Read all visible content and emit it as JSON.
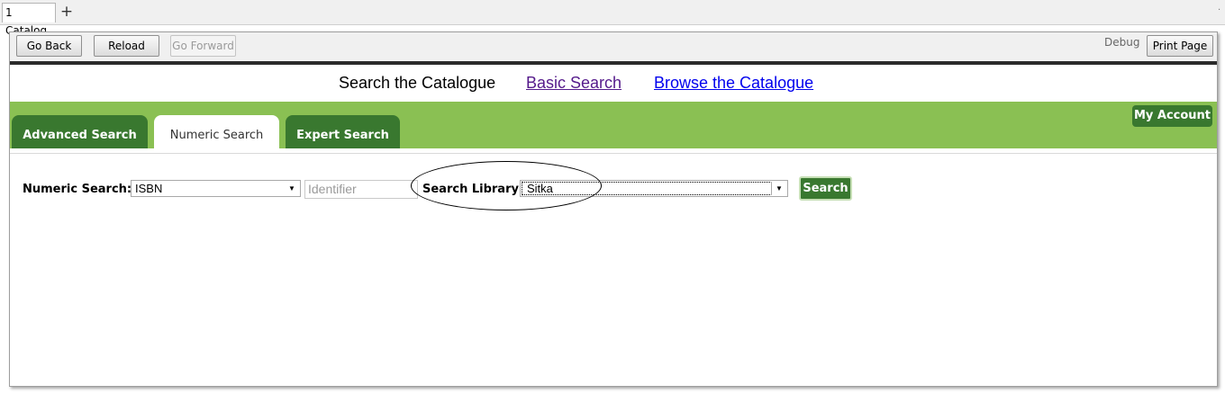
{
  "browser": {
    "tab_label": "1 Catalog",
    "new_tab_symbol": "+",
    "edge_mark": "·"
  },
  "toolbar": {
    "go_back": "Go Back",
    "reload": "Reload",
    "go_forward": "Go Forward",
    "debug": "Debug",
    "print_page": "Print Page"
  },
  "topnav": {
    "current": "Search the Catalogue",
    "basic_search": "Basic Search",
    "browse": "Browse the Catalogue"
  },
  "tabs": [
    {
      "label": "Advanced Search",
      "active": false
    },
    {
      "label": "Numeric Search",
      "active": true
    },
    {
      "label": "Expert Search",
      "active": false
    }
  ],
  "account_button": "My Account",
  "search_form": {
    "numeric_label": "Numeric Search:",
    "numeric_type_value": "ISBN",
    "identifier_placeholder": "Identifier",
    "library_label": "Search Library:",
    "library_value": "Sitka",
    "search_button": "Search"
  },
  "colors": {
    "green_bar": "#8ac053",
    "dark_green": "#39782f",
    "visited_link": "#551a8b",
    "link": "#0000ee"
  }
}
